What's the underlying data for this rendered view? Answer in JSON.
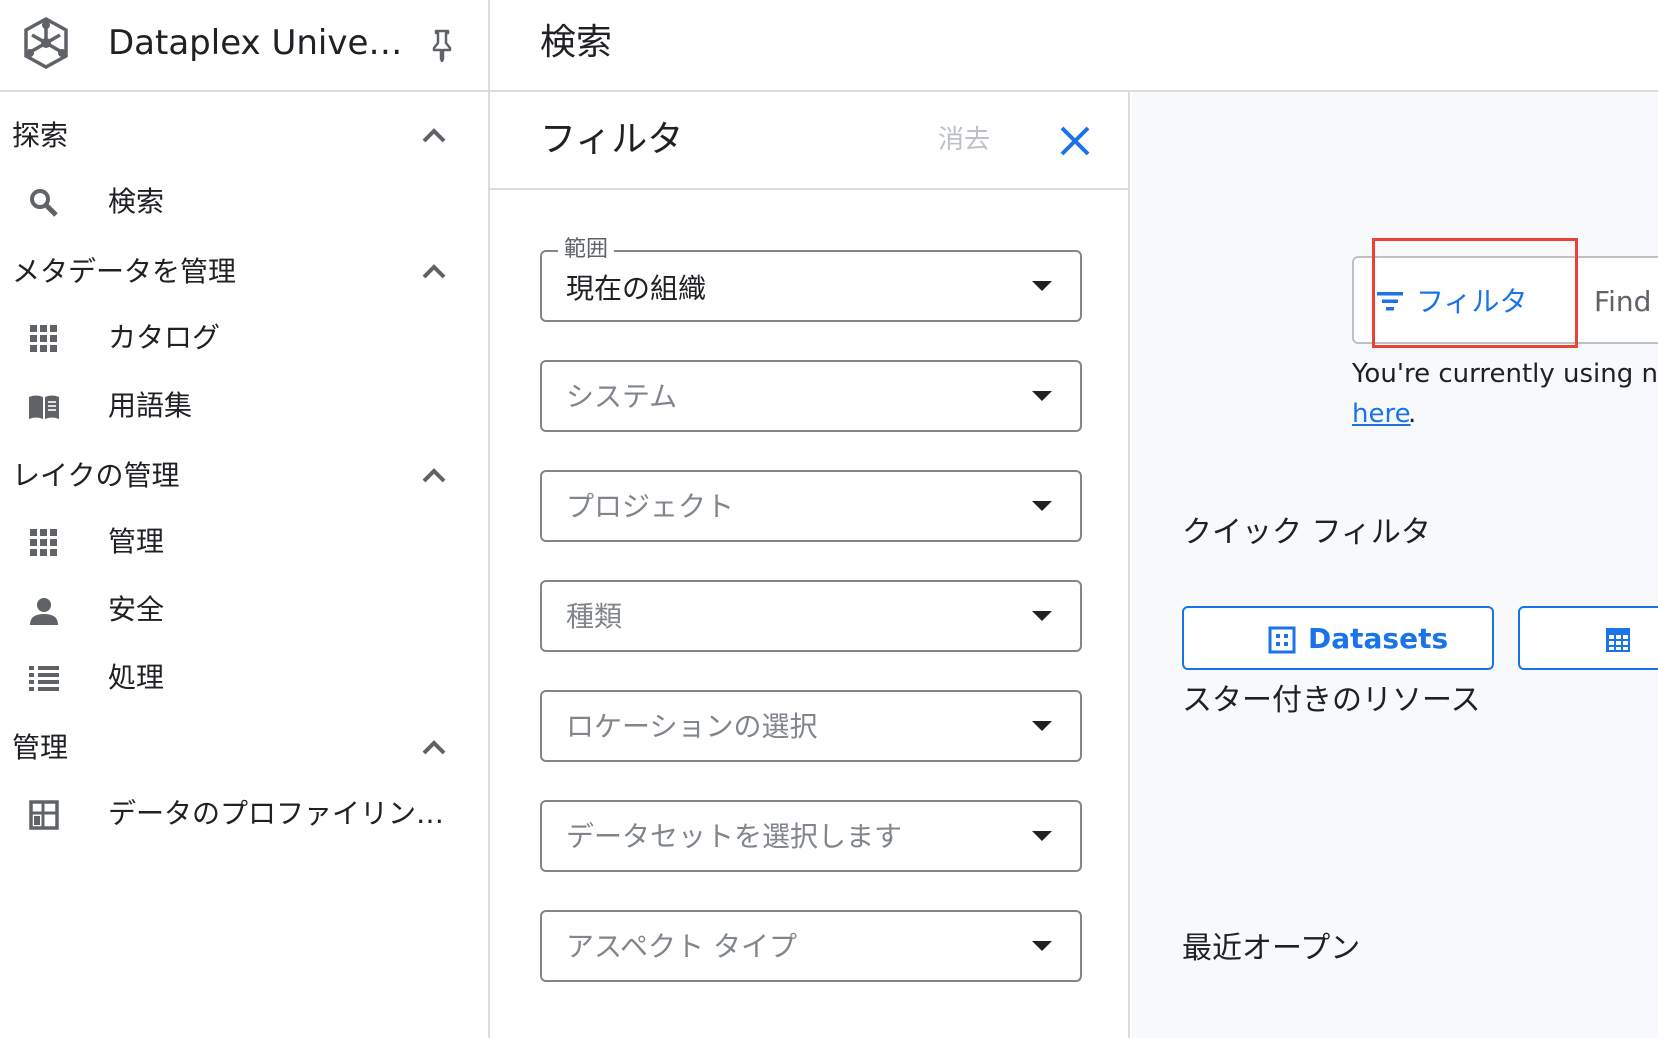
{
  "app": {
    "title": "Dataplex Universal Catalog",
    "logo_icon": "dataplex-logo-icon",
    "pin_icon": "pin-icon"
  },
  "sidebar": {
    "sections": [
      {
        "title": "探索",
        "items": [
          {
            "label": "検索",
            "icon": "search-icon"
          }
        ]
      },
      {
        "title": "メタデータを管理",
        "items": [
          {
            "label": "カタログ",
            "icon": "grid-icon"
          },
          {
            "label": "用語集",
            "icon": "book-icon"
          }
        ]
      },
      {
        "title": "レイクの管理",
        "items": [
          {
            "label": "管理",
            "icon": "grid-icon"
          },
          {
            "label": "安全",
            "icon": "person-icon"
          },
          {
            "label": "処理",
            "icon": "list-icon"
          }
        ]
      },
      {
        "title": "管理",
        "items": [
          {
            "label": "データのプロファイリングと品質",
            "icon": "table-icon"
          }
        ]
      }
    ]
  },
  "header": {
    "title": "検索"
  },
  "filter_panel": {
    "title": "フィルタ",
    "clear_label": "消去",
    "close_icon": "close-icon",
    "dropdowns": [
      {
        "label": "範囲",
        "value": "現在の組織"
      },
      {
        "placeholder": "システム"
      },
      {
        "placeholder": "プロジェクト"
      },
      {
        "placeholder": "種類"
      },
      {
        "placeholder": "ロケーションの選択"
      },
      {
        "placeholder": "データセットを選択します"
      },
      {
        "placeholder": "アスペクト タイプ"
      }
    ]
  },
  "content": {
    "filter_button_label": "フィルタ",
    "search_placeholder": "Find r",
    "notice_text": "You're currently using nat",
    "notice_link": "here",
    "notice_suffix": ".",
    "quick_filters_title": "クイック フィルタ",
    "quick_filters": [
      {
        "label": "Datasets",
        "icon": "dataset-icon"
      },
      {
        "label": "",
        "icon": "table-icon"
      }
    ],
    "starred_title": "スター付きのリソース",
    "recent_title": "最近オープン"
  },
  "colors": {
    "accent": "#1a73e8",
    "highlight": "#ea4335",
    "border": "#dadce0",
    "muted": "#80868b"
  }
}
